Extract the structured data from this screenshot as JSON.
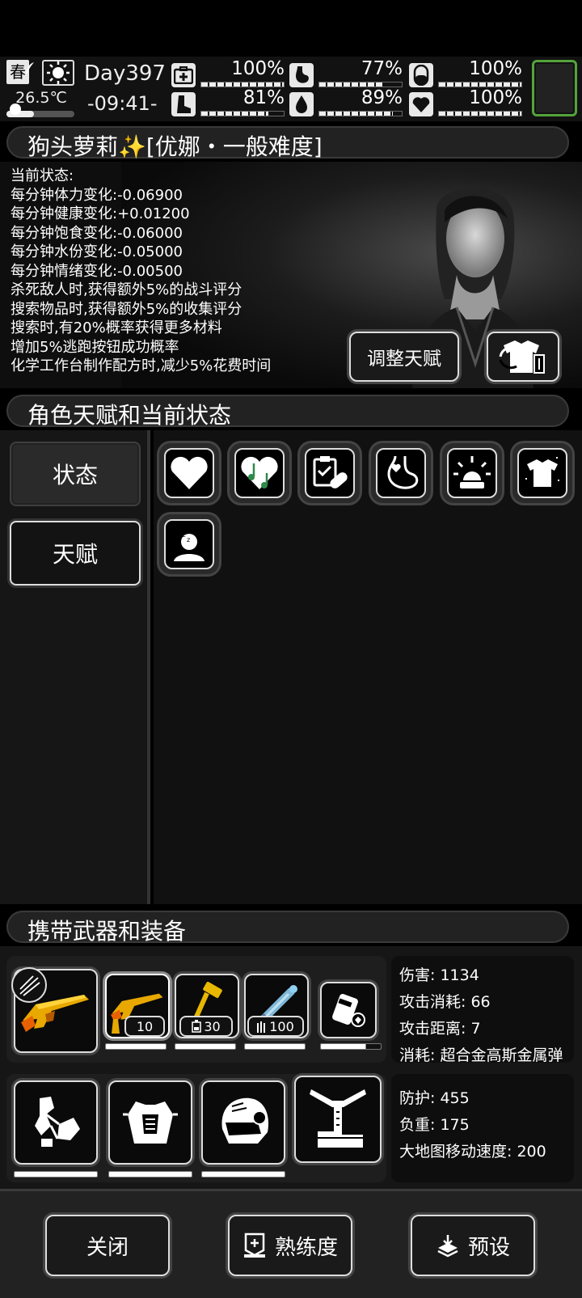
{
  "topbar": {
    "season": "春",
    "temperature": "26.5℃",
    "temperature_level": 0.4,
    "day": "Day397",
    "time": "-09:41-",
    "stats": [
      {
        "name": "first-aid-icon",
        "value": "100%",
        "level": 1.0
      },
      {
        "name": "stomach-icon",
        "value": "77%",
        "level": 0.77
      },
      {
        "name": "capsule-icon",
        "value": "100%",
        "level": 1.0
      },
      {
        "name": "boot-icon",
        "value": "81%",
        "level": 0.81
      },
      {
        "name": "water-drop-icon",
        "value": "89%",
        "level": 0.89
      },
      {
        "name": "heart-icon",
        "value": "100%",
        "level": 1.0
      }
    ],
    "accent_green": "#54a33a"
  },
  "character": {
    "title": "狗头萝莉✨[优娜・一般难度]",
    "status_header": "当前状态:",
    "status_lines": [
      "每分钟体力变化:-0.06900",
      "每分钟健康变化:+0.01200",
      "每分钟饱食变化:-0.06000",
      "每分钟水份变化:-0.05000",
      "每分钟情绪变化:-0.00500",
      "杀死敌人时,获得额外5%的战斗评分",
      "搜索物品时,获得额外5%的收集评分",
      "搜索时,有20%概率获得更多材料",
      "增加5%逃跑按钮成功概率",
      "化学工作台制作配方时,减少5%花费时间"
    ],
    "adjust_talent_label": "调整天赋"
  },
  "talents_section": {
    "title": "角色天赋和当前状态",
    "tabs": [
      "状态",
      "天赋"
    ],
    "icons": [
      "heart-icon",
      "music-heart-icon",
      "clipboard-pill-icon",
      "stomach-heart-icon",
      "alarm-light-icon",
      "shirt-sparkle-icon",
      "sleeping-person-icon"
    ]
  },
  "equipment": {
    "title": "携带武器和装备",
    "weapon_counts": [
      "10",
      "30",
      "100"
    ],
    "weapon_stats": [
      "伤害: 1134",
      "攻击消耗: 66",
      "攻击距离: 7",
      "消耗: 超合金高斯金属弹"
    ],
    "armor_stats": [
      "防护: 455",
      "负重: 175",
      "大地图移动速度: 200"
    ]
  },
  "bottom": {
    "close_label": "关闭",
    "proficiency_label": "熟练度",
    "preset_label": "预设"
  }
}
